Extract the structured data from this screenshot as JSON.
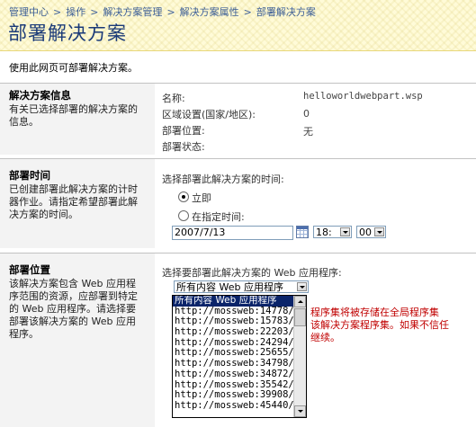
{
  "breadcrumb": {
    "items": [
      "管理中心",
      "操作",
      "解决方案管理",
      "解决方案属性",
      "部署解决方案"
    ],
    "separator": ">"
  },
  "page_title": "部署解决方案",
  "intro": "使用此网页可部署解决方案。",
  "solution_info": {
    "title": "解决方案信息",
    "description": "有关已选择部署的解决方案的信息。",
    "fields": [
      {
        "label": "名称:",
        "value": "helloworldwebpart.wsp"
      },
      {
        "label": "区域设置(国家/地区):",
        "value": "0"
      },
      {
        "label": "部署位置:",
        "value": "无"
      },
      {
        "label": "部署状态:",
        "value": ""
      }
    ]
  },
  "deploy_time": {
    "title": "部署时间",
    "description": "已创建部署此解决方案的计时器作业。请指定希望部署此解决方案的时间。",
    "prompt": "选择部署此解决方案的时间:",
    "option_now": "立即",
    "option_specific": "在指定时间:",
    "selected": "立即",
    "date_value": "2007/7/13",
    "hour_value": "18:",
    "minute_value": "00"
  },
  "deploy_location": {
    "title": "部署位置",
    "description": "该解决方案包含 Web 应用程序范围的资源，应部署到特定的 Web 应用程序。请选择要部署该解决方案的 Web 应用程序。",
    "prompt": "选择要部署此解决方案的 Web 应用程序:",
    "selected_value": "所有内容 Web 应用程序",
    "options": [
      "所有内容 Web 应用程序",
      "http://mossweb:14778/",
      "http://mossweb:15783/",
      "http://mossweb:22203/",
      "http://mossweb:24294/",
      "http://mossweb:25655/",
      "http://mossweb:34798/",
      "http://mossweb:34872/",
      "http://mossweb:35542/",
      "http://mossweb:39908/",
      "http://mossweb:45440/"
    ],
    "warning_lines": [
      "程序集将被存储在全局程序集",
      "该解决方案程序集。如果不信任",
      "继续。"
    ]
  },
  "colors": {
    "header_bg": "#fffbd8",
    "title_color": "#1a3a78",
    "link_color": "#3d5f96",
    "warning_color": "#c00000",
    "selection_bg": "#0a246a"
  }
}
